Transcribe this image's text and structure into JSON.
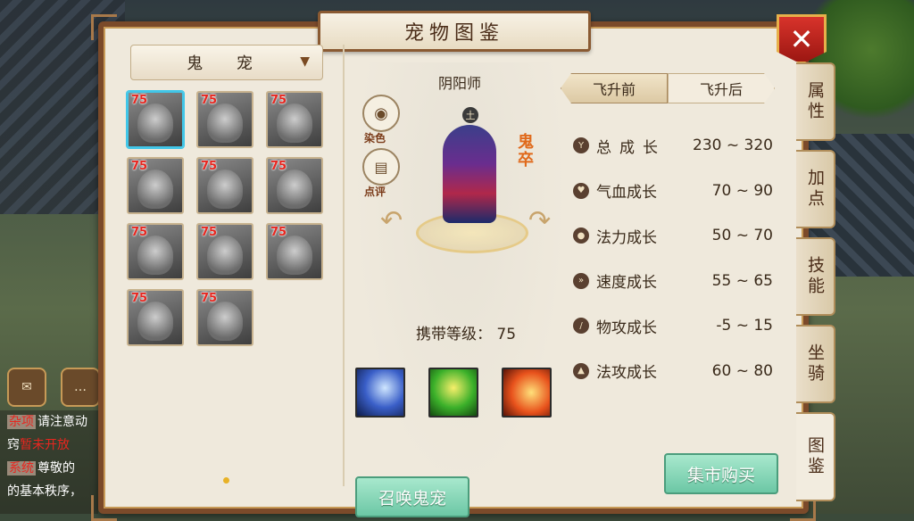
{
  "window": {
    "title": "宠物图鉴"
  },
  "left": {
    "category_dropdown": "鬼 宠",
    "dropdown_arrow": "▼",
    "pets": [
      {
        "level": "75",
        "selected": true
      },
      {
        "level": "75"
      },
      {
        "level": "75"
      },
      {
        "level": "75"
      },
      {
        "level": "75"
      },
      {
        "level": "75"
      },
      {
        "level": "75"
      },
      {
        "level": "75"
      },
      {
        "level": "75"
      },
      {
        "level": "75"
      },
      {
        "level": "75"
      }
    ]
  },
  "center": {
    "pet_name": "阴阳师",
    "dye_label": "染色",
    "review_label": "点评",
    "element_badge": "土",
    "pet_type_vertical": "鬼卒",
    "carry_level_label": "携带等级：",
    "carry_level_value": "75",
    "summon_button": "召唤鬼宠"
  },
  "right": {
    "tabs": [
      {
        "label": "飞升前",
        "active": true
      },
      {
        "label": "飞升后",
        "active": false
      }
    ],
    "stats": [
      {
        "label": "总成长",
        "value": "230 ~ 320"
      },
      {
        "label": "气血成长",
        "value": "70 ~ 90"
      },
      {
        "label": "法力成长",
        "value": "50 ~ 70"
      },
      {
        "label": "速度成长",
        "value": "55 ~ 65"
      },
      {
        "label": "物攻成长",
        "value": "-5 ~ 15"
      },
      {
        "label": "法攻成长",
        "value": "60 ~ 80"
      }
    ],
    "market_button": "集市购买"
  },
  "side_tabs": [
    {
      "label": "属性"
    },
    {
      "label": "加点"
    },
    {
      "label": "技能"
    },
    {
      "label": "坐骑"
    },
    {
      "label": "图鉴",
      "active": true
    }
  ],
  "chat": {
    "lines": [
      {
        "tag": "杂项",
        "text": "请注意动"
      },
      {
        "prefix": "窍",
        "red": "暂未开放"
      },
      {
        "tag": "系统",
        "text": "尊敬的"
      },
      {
        "text": "的基本秩序，"
      }
    ]
  },
  "colors": {
    "frame_brown": "#7b4a2a",
    "panel_bg": "#efe9dc",
    "level_red": "#e8261f",
    "button_green": "#6cc7a5",
    "pet_type_orange": "#e06a1c"
  }
}
